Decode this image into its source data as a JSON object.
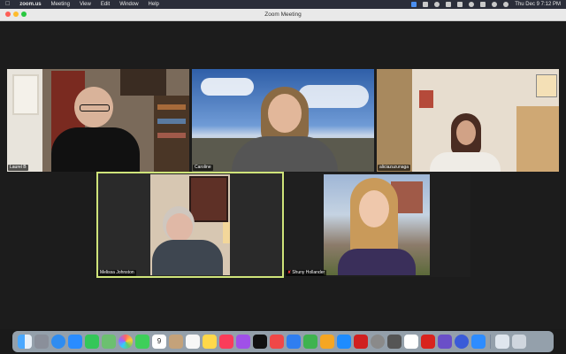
{
  "menubar": {
    "apple": "",
    "app_name": "zoom.us",
    "menus": [
      "Meeting",
      "View",
      "Edit",
      "Window",
      "Help"
    ],
    "datetime": "Thu Dec 9  7:12 PM"
  },
  "window": {
    "title": "Zoom Meeting"
  },
  "participants": [
    {
      "name": "Laurel B"
    },
    {
      "name": "Caroline"
    },
    {
      "name": "aliciazuzunaga"
    },
    {
      "name": "Melissa Johnston",
      "active_speaker": true
    },
    {
      "name": "Shuny Hollander",
      "muted": true
    }
  ],
  "dock": {
    "apps": [
      "finder-icon",
      "launchpad-icon",
      "safari-icon",
      "mail-icon",
      "messages-icon",
      "maps-icon",
      "photos-icon",
      "facetime-icon",
      "calendar-icon",
      "contacts-icon",
      "reminders-icon",
      "notes-icon",
      "music-icon",
      "podcasts-icon",
      "tv-icon",
      "news-icon",
      "keynote-icon",
      "numbers-icon",
      "pages-icon",
      "app-store-icon",
      "bbedit-icon",
      "system-preferences-icon",
      "calculator-icon",
      "slack-icon",
      "acrobat-icon",
      "instruments-icon",
      "chrome-helper-icon",
      "zoom-icon",
      "documents-icon",
      "trash-icon"
    ],
    "calendar_day": "9"
  }
}
